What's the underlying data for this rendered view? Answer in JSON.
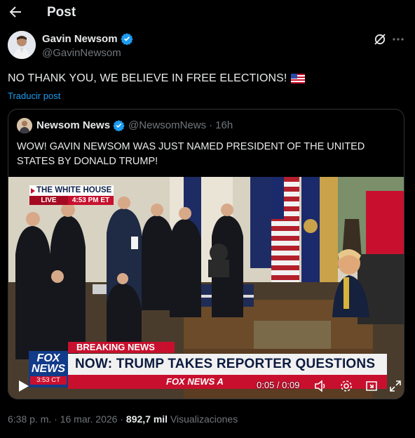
{
  "header": {
    "back_icon": "arrow-left-icon",
    "title": "Post"
  },
  "author": {
    "name": "Gavin Newsom",
    "handle": "@GavinNewsom",
    "verified_color": "#1d9bf0"
  },
  "post": {
    "text": "NO THANK YOU, WE BELIEVE IN FREE ELECTIONS!",
    "emoji": "us-flag",
    "translate_label": "Traducir post"
  },
  "quoted": {
    "name": "Newsom News",
    "handle": "@NewsomNews",
    "separator": "·",
    "age": "16h",
    "text": "WOW! GAVIN NEWSOM WAS JUST NAMED PRESIDENT OF THE UNITED STATES BY DONALD TRUMP!",
    "video": {
      "bug_title": "THE WHITE HOUSE",
      "bug_live": "LIVE",
      "bug_time": "4:53 PM ET",
      "breaking_label": "BREAKING NEWS",
      "headline": "NOW: TRUMP TAKES REPORTER QUESTIONS",
      "fox_line1": "FOX",
      "fox_line2": "NEWS",
      "fox_clock": "3:53 CT",
      "ticker_text": "FOX NEWS A",
      "elapsed": "0:05",
      "duration": "0:09",
      "timer_sep": " / ",
      "progress": 0.55
    }
  },
  "meta": {
    "time": "6:38 p. m.",
    "date": "16 mar. 2026",
    "dot": " · ",
    "views_count": "892,7 mil",
    "views_label": "Visualizaciones"
  },
  "colors": {
    "accent": "#1d9bf0",
    "fox_red": "#c8102e",
    "fox_blue": "#123b8a"
  }
}
